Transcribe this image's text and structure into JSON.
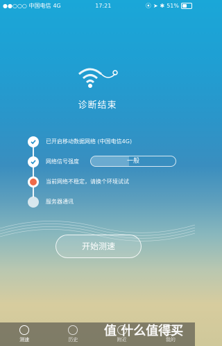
{
  "status_bar": {
    "carrier": "●●○○○ 中国电信",
    "network": "4G",
    "time": "17:21",
    "battery": "51%"
  },
  "hero": {
    "title": "诊断结束"
  },
  "steps": [
    {
      "label": "已开启移动数据网络 (中国电信4G)",
      "state": "done"
    },
    {
      "label": "网络信号强度",
      "state": "done",
      "meter_label": "一般",
      "meter_value": 0.45
    },
    {
      "label": "当前网络不稳定，请换个环境试试",
      "state": "warning"
    },
    {
      "label": "服务器通讯",
      "state": "pending"
    }
  ],
  "start_button": {
    "label": "开始测速"
  },
  "tabs": [
    {
      "label": "测速",
      "icon": "speed-icon",
      "active": true
    },
    {
      "label": "历史",
      "icon": "history-icon",
      "active": false
    },
    {
      "label": "附近",
      "icon": "nearby-icon",
      "active": false
    },
    {
      "label": "我的",
      "icon": "profile-icon",
      "active": false
    }
  ],
  "watermark": "值 什么值得买"
}
